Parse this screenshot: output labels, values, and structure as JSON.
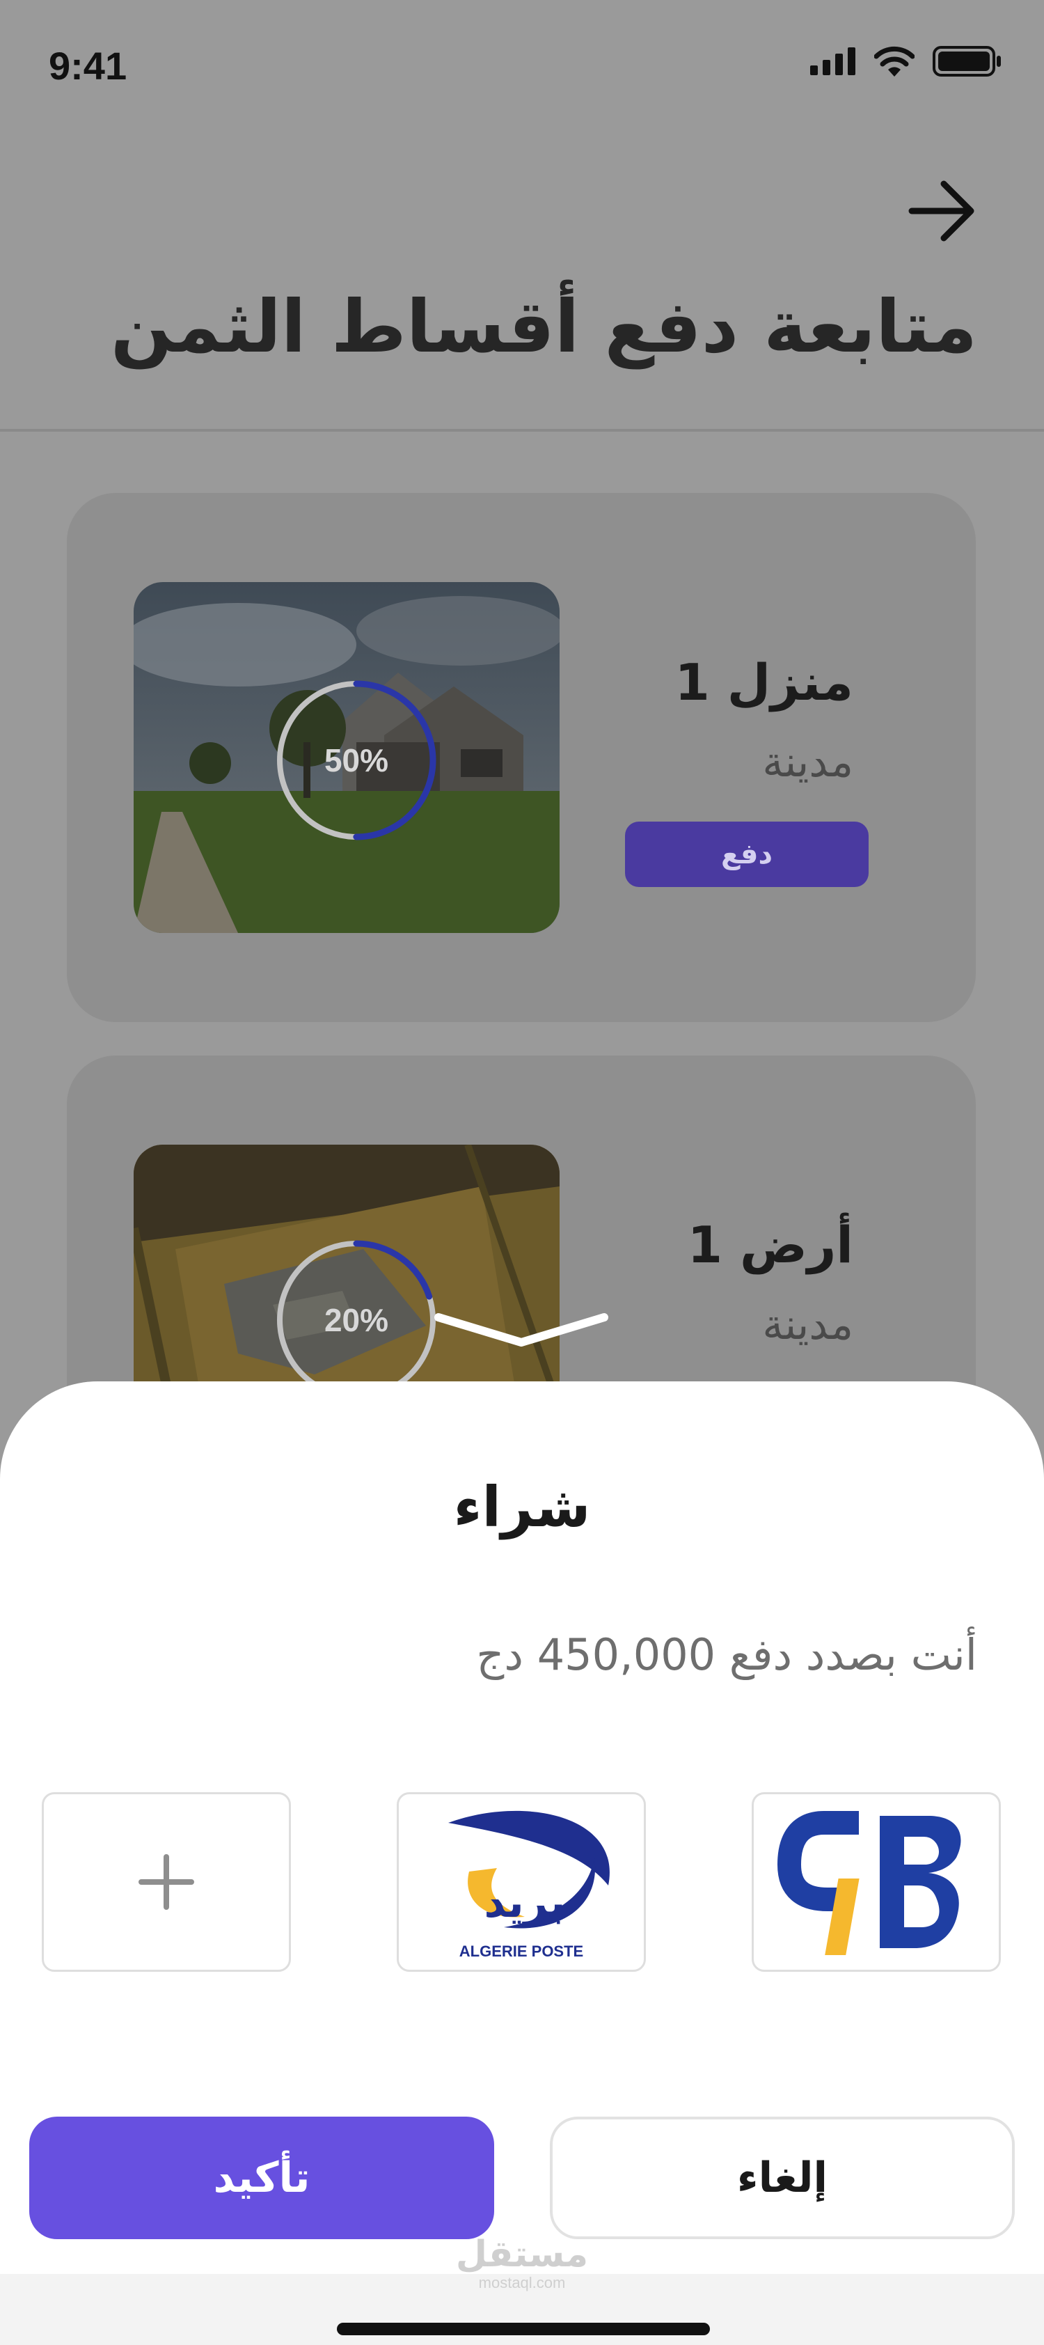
{
  "status_bar": {
    "time": "9:41"
  },
  "header": {
    "title": "متابعة دفع أقساط الثمن"
  },
  "cards": [
    {
      "title": "منزل 1",
      "subtitle": "مدينة",
      "progress_label": "50%",
      "progress": 0.5,
      "pay_label": "دفع"
    },
    {
      "title": "أرض 1",
      "subtitle": "مدينة",
      "progress_label": "20%",
      "progress": 0.2
    }
  ],
  "sheet": {
    "title": "شراء",
    "message": "أنت بصدد دفع 450,000 دج",
    "methods": [
      {
        "name": "add-method",
        "icon": "plus-icon"
      },
      {
        "name": "algerie-poste",
        "logo_text": "ALGERIE POSTE"
      },
      {
        "name": "cib",
        "logo_text": "CIB"
      }
    ],
    "confirm_label": "تأكيد",
    "cancel_label": "إلغاء"
  },
  "watermark": {
    "arabic": "مستقل",
    "latin": "mostaql.com"
  },
  "colors": {
    "accent": "#6750e0",
    "pay_button": "#4a3aa0",
    "ring": "#2a36a8",
    "cib_blue": "#1f3fa3",
    "cib_yellow": "#f5b82e"
  }
}
